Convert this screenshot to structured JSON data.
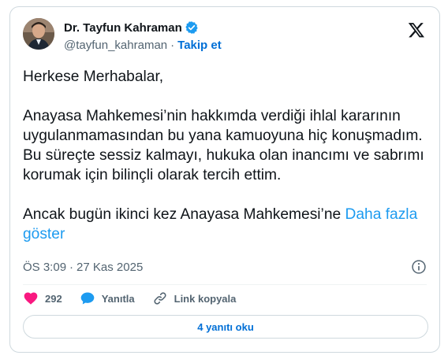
{
  "author": {
    "display_name": "Dr. Tayfun Kahraman",
    "handle": "@tayfun_kahraman",
    "separator": "·",
    "follow_label": "Takip et"
  },
  "tweet": {
    "paragraphs": [
      "Herkese Merhabalar,",
      "Anayasa Mahkemesi’nin hakkımda verdiği ihlal kararının uygulanmamasından bu yana kamuoyuna hiç konuşmadım. Bu süreçte sessiz kalmayı, hukuka olan inancımı ve sabrımı korumak için bilinçli olarak tercih ettim.",
      "Ancak bugün ikinci kez Anayasa Mahkemesi’ne"
    ],
    "show_more_label": "Daha fazla göster",
    "time": "ÖS 3:09",
    "meta_separator": "·",
    "date": "27 Kas 2025"
  },
  "actions": {
    "like_count": "292",
    "reply_label": "Yanıtla",
    "copy_link_label": "Link kopyala"
  },
  "replies_button_label": "4 yanıtı oku",
  "colors": {
    "accent": "#1d9bf0",
    "link_dark": "#006fd6",
    "like": "#f91880",
    "muted": "#536471",
    "verified": "#1d9bf0"
  },
  "icons": {
    "brand": "x-logo-icon",
    "verified": "verified-badge-icon",
    "info": "info-icon",
    "like": "heart-icon",
    "reply": "speech-bubble-icon",
    "copy_link": "link-icon"
  }
}
